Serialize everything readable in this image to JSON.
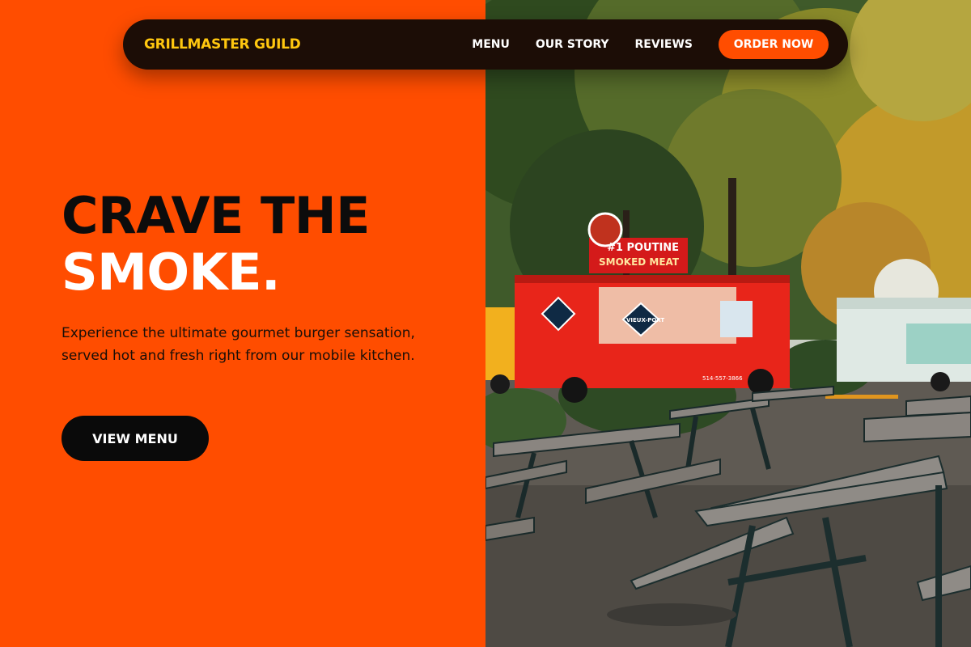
{
  "nav": {
    "brand": "GRILLMASTER GUILD",
    "links": [
      "MENU",
      "OUR STORY",
      "REVIEWS"
    ],
    "cta": "ORDER NOW"
  },
  "hero": {
    "title_line1": "CRAVE THE",
    "title_line2": "SMOKE.",
    "description": "Experience the ultimate gourmet burger sensation, served hot and fresh right from our mobile kitchen.",
    "button": "VIEW MENU"
  },
  "photo": {
    "truck_sign": "#1 POUTINE",
    "truck_sign2": "SMOKED MEAT",
    "truck_badge": "VIEUX-PORT",
    "truck_phone": "514-557-3866"
  },
  "colors": {
    "accent": "#ff4d00",
    "brand_yellow": "#ffc70f",
    "nav_bg": "#1c0d06"
  }
}
